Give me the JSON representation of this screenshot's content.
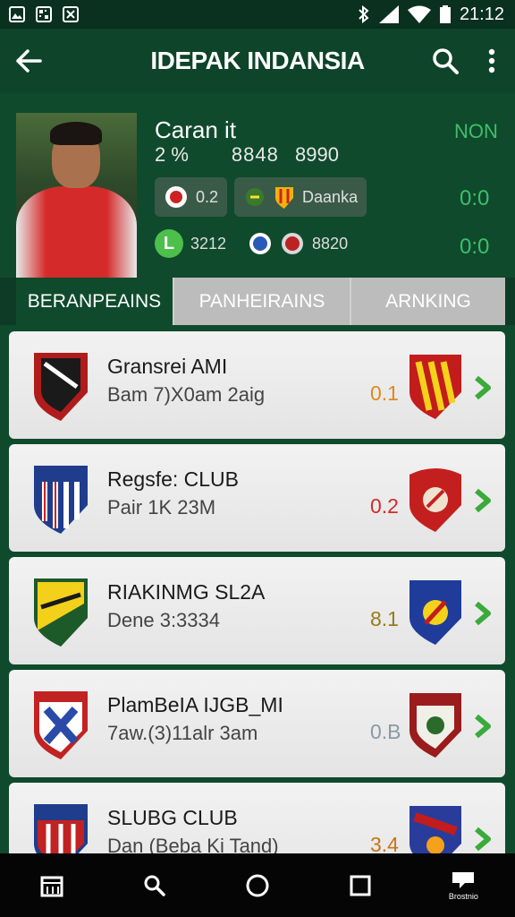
{
  "status_bar": {
    "time": "21:12",
    "left_icons": [
      "image-notification-icon",
      "qr-notification-icon",
      "sports-notification-icon"
    ],
    "right_icons": [
      "bluetooth-icon",
      "signal-icon",
      "wifi-icon",
      "battery-icon"
    ]
  },
  "app_bar": {
    "title": "IDEPAK INDANSIA",
    "back_icon": "back-arrow-icon",
    "search_icon": "search-icon",
    "menu_icon": "more-vert-icon"
  },
  "profile": {
    "name": "Caran it",
    "meta_left": "2 %",
    "meta_mid": "8848",
    "meta_right": "8990",
    "now_label": "NON",
    "stats": [
      {
        "chip1_value": "0.2",
        "chip2_label": "Daanka",
        "score": "0:0"
      },
      {
        "badge": "L",
        "value1": "3212",
        "value2": "8820",
        "score": "0:0"
      }
    ]
  },
  "tabs": [
    {
      "label": "BERANPEAINS",
      "active": true
    },
    {
      "label": "PANHEIRAINS",
      "active": false
    },
    {
      "label": "ARNKING",
      "active": false
    }
  ],
  "colors": {
    "dark_green": "#0e4429",
    "accent_green": "#3fbf6a",
    "tab_inactive": "#bcbcbc",
    "score_orange": "#e08a1a",
    "score_red": "#d42a2a",
    "score_olive": "#9a7a1a",
    "score_gray": "#8a9aa4",
    "score_amber": "#c8731a"
  },
  "clubs": [
    {
      "title": "Gransrei AMI",
      "subtitle": "Bam 7)X0am 2aig",
      "score": "0.1",
      "score_color": "#e08a1a"
    },
    {
      "title": "Regsfe: CLUB",
      "subtitle": "Pair 1K 23M",
      "score": "0.2",
      "score_color": "#d42a2a"
    },
    {
      "title": "RIAKINMG SL2A",
      "subtitle": "Dene 3:3334",
      "score": "8.1",
      "score_color": "#9a7a1a"
    },
    {
      "title": "PlamBeIA IJGB_MI",
      "subtitle": "7aw.(3)11alr 3am",
      "score": "0.B",
      "score_color": "#8a9aa4"
    },
    {
      "title": "SLUBG CLUB",
      "subtitle": "Dan (Beba Ki Tand)",
      "score": "3.4",
      "score_color": "#c8731a"
    }
  ],
  "nav": {
    "items": [
      "calendar-icon",
      "search-icon",
      "home-circle-icon",
      "recents-square-icon",
      "chat-icon"
    ],
    "chat_label": "Brostnio"
  }
}
